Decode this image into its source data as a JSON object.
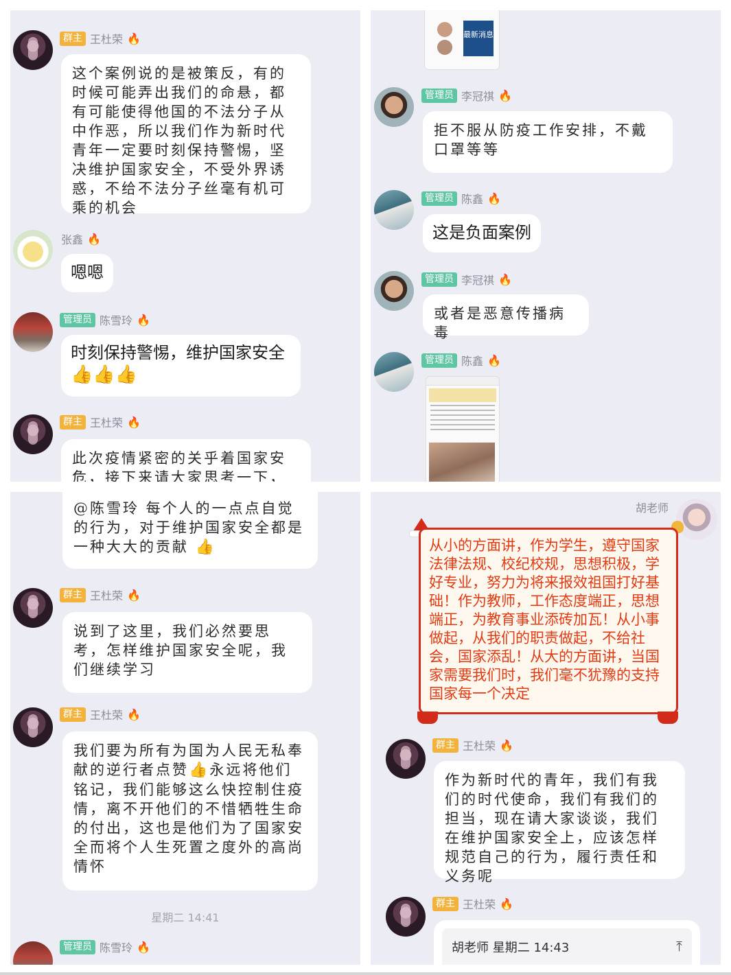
{
  "p1": {
    "m1": {
      "badge": "群主",
      "name": "王杜荣",
      "text": "这个案例说的是被策反，有的时候可能弄出我们的命悬，都有可能使得他国的不法分子从中作恶，所以我们作为新时代青年一定要时刻保持警惕，坚决维护国家安全，不受外界诱惑，不给不法分子丝毫有机可乘的机会"
    },
    "m2": {
      "name": "张鑫",
      "text": "嗯嗯"
    },
    "m3": {
      "badge": "管理员",
      "name": "陈雪玲",
      "text": "时刻保持警惕，维护国家安全",
      "emoji": "👍👍👍"
    },
    "m4": {
      "badge": "群主",
      "name": "王杜荣",
      "text": "此次疫情紧密的关乎着国家安危，接下来请大家思考一下，疫"
    }
  },
  "p2": {
    "m1": {
      "badge": "管理员",
      "name": "李冠祺",
      "text": "拒不服从防疫工作安排，不戴口罩等等"
    },
    "m2": {
      "badge": "管理员",
      "name": "陈鑫",
      "text": "这是负面案例"
    },
    "m3": {
      "badge": "管理员",
      "name": "李冠祺",
      "text": "或者是恶意传播病毒"
    },
    "m4": {
      "badge": "管理员",
      "name": "陈鑫"
    },
    "img_top_title": "最新消息"
  },
  "p3": {
    "m0": {
      "text": "@陈雪玲 每个人的一点点自觉的行为，对于维护国家安全都是一种大大的贡献",
      "emoji": "👍"
    },
    "m1": {
      "badge": "群主",
      "name": "王杜荣",
      "text": "说到了这里，我们必然要思考，怎样维护国家安全呢，我们继续学习"
    },
    "m2": {
      "badge": "群主",
      "name": "王杜荣",
      "text_a": "我们要为所有为国为人民无私奉献的逆行者点赞",
      "emoji": "👍",
      "text_b": "永远将他们铭记，我们能够这么快控制住疫情，离不开他们的不惜牺牲生命的付出，这也是他们为了国家安全而将个人生死置之度外的高尚情怀"
    },
    "time": "星期二 14:41",
    "m3": {
      "badge": "管理员",
      "name": "陈雪玲"
    }
  },
  "p4": {
    "m1": {
      "name": "胡老师",
      "text": "从小的方面讲，作为学生，遵守国家法律法规、校纪校规，思想积极，学好专业，努力为将来报效祖国打好基础！作为教师，工作态度端正，思想端正，为教育事业添砖加瓦！从小事做起，从我们的职责做起，不给社会，国家添乱！从大的方面讲，当国家需要我们时，我们毫不犹豫的支持国家每一个决定"
    },
    "m2": {
      "badge": "群主",
      "name": "王杜荣",
      "text": "作为新时代的青年，我们有我们的时代使命，我们有我们的担当，现在请大家谈谈，我们在维护国家安全上，应该怎样规范自己的行为，履行责任和义务呢"
    },
    "m3": {
      "badge": "群主",
      "name": "王杜荣",
      "reply_head": "胡老师 星期二 14:43"
    }
  },
  "colors": {
    "owner_badge": "#f3b23b",
    "admin_badge": "#5fc6a4",
    "panel_bg": "#ececf4",
    "red_text": "#e23a12"
  }
}
